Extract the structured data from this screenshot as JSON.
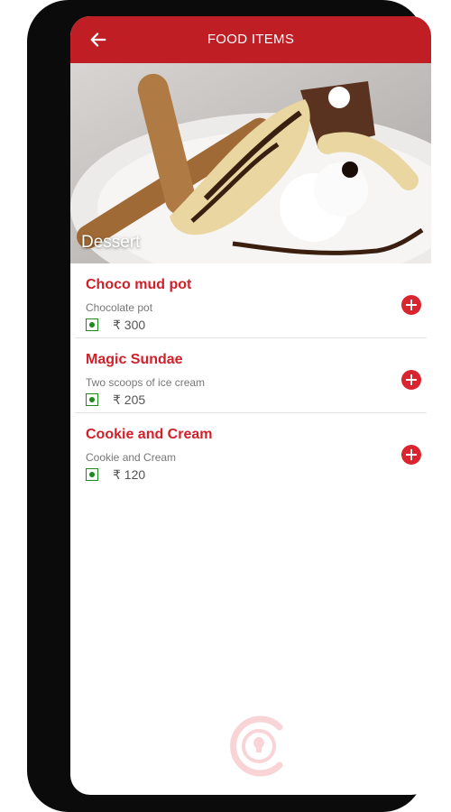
{
  "header": {
    "title": "FOOD ITEMS",
    "back_icon": "arrow-left-icon"
  },
  "hero": {
    "label": "Dessert"
  },
  "items": [
    {
      "name": "Choco mud pot",
      "description": "Chocolate pot",
      "price": "₹ 300"
    },
    {
      "name": "Magic Sundae",
      "description": "Two scoops of ice cream",
      "price": "₹ 205"
    },
    {
      "name": "Cookie and Cream",
      "description": "Cookie and Cream",
      "price": "₹ 120"
    }
  ],
  "colors": {
    "accent": "#be1e24",
    "item_name": "#d0202a",
    "veg": "#1c8a1c",
    "add_button": "#d9252f"
  }
}
